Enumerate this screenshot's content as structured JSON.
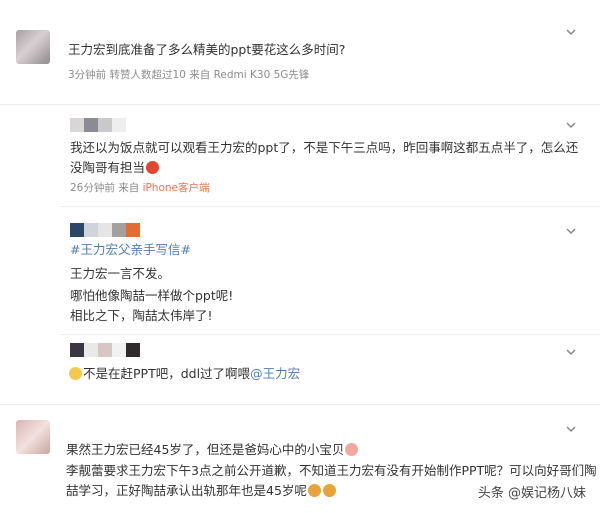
{
  "comments": [
    {
      "text": "王力宏到底准备了多么精美的ppt要花这么多时间?",
      "meta_time": "3分钟前",
      "meta_mid": "转赞人数超过10",
      "meta_from": "来自",
      "meta_source": "Redmi K30 5G先锋"
    },
    {
      "line1": "我还以为饭点就可以观看王力宏的ppt了，不是下午三点吗，昨回事啊这都五点半了，怎么还",
      "line2": "没陶哥有担当",
      "meta_time": "26分钟前",
      "meta_from": "来自",
      "meta_source": "iPhone客户端"
    },
    {
      "hashtag": "#王力宏父亲手写信#",
      "line1": "王力宏一言不发。",
      "line2": "哪怕他像陶喆一样做个ppt呢!",
      "line3": "相比之下，陶喆太伟岸了!"
    },
    {
      "text": "不是在赶PPT吧，ddl过了啊喂",
      "mention": "@王力宏"
    },
    {
      "line1": "果然王力宏已经45岁了，但还是爸妈心中的小宝贝",
      "line2": "李靓蕾要求王力宏下午3点之前公开道歉，不知道王力宏有没有开始制作PPT呢？可以向好哥们陶",
      "line3": "喆学习，正好陶喆承认出轨那年也是45岁呢"
    }
  ],
  "watermark": "头条 @娱记杨八妹",
  "icons": {
    "more": "chevron-down-icon",
    "emoji": "emoji-icon"
  },
  "colors": {
    "link": "#507daf",
    "source": "#eb7350",
    "meta": "#8c8c8c"
  }
}
